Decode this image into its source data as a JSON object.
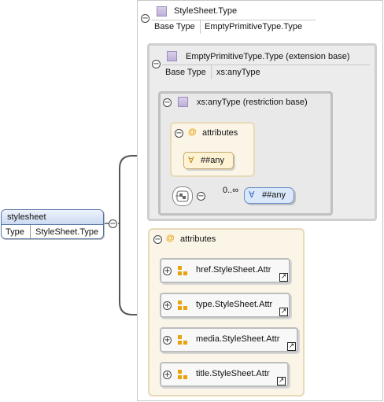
{
  "root": {
    "name": "stylesheet",
    "type_label": "Type",
    "type_value": "StyleSheet.Type"
  },
  "stylesheet_type": {
    "title": "StyleSheet.Type",
    "base_label": "Base Type",
    "base_value": "EmptyPrimitiveType.Type"
  },
  "extension": {
    "title": "EmptyPrimitiveType.Type (extension base)",
    "base_label": "Base Type",
    "base_value": "xs:anyType"
  },
  "restriction": {
    "title": "xs:anyType (restriction base)",
    "attributes_label": "attributes",
    "any_attribute": "##any",
    "occurrence": "0..∞",
    "any_element": "##any"
  },
  "attributes": {
    "label": "attributes",
    "items": [
      "href.StyleSheet.Attr",
      "type.StyleSheet.Attr",
      "media.StyleSheet.Attr",
      "title.StyleSheet.Attr"
    ]
  },
  "icons": {
    "collapse": "minus",
    "expand": "plus",
    "attribute": "at-sign",
    "any": "forall",
    "link": "arrow"
  },
  "colors": {
    "root_fill": "#dde8f8",
    "attr_group": "#fbf5e8",
    "any_attr": "#fff3d6",
    "any_elem": "#dbe8fb",
    "type_icon": "#c9bddf"
  }
}
